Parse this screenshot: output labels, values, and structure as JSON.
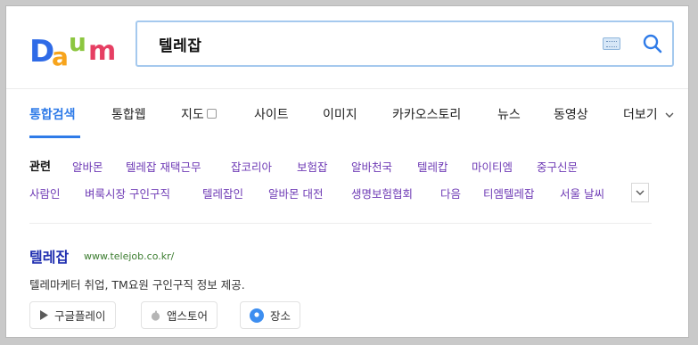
{
  "logo": {
    "text": "Daum",
    "colors": [
      "#2f6be7",
      "#f7a41c",
      "#8cc63f",
      "#e63f63"
    ]
  },
  "search": {
    "value": "텔레잡"
  },
  "tabs": [
    {
      "label": "통합검색",
      "active": true
    },
    {
      "label": "통합웹"
    },
    {
      "label": "지도"
    },
    {
      "label": "사이트"
    },
    {
      "label": "이미지"
    },
    {
      "label": "카카오스토리"
    },
    {
      "label": "뉴스"
    },
    {
      "label": "동영상"
    },
    {
      "label": "더보기"
    }
  ],
  "related": {
    "label": "관련",
    "row1": [
      "알바몬",
      "텔레잡 재택근무",
      "잡코리아",
      "보험잡",
      "알바천국",
      "텔레캅",
      "마이티엠",
      "중구신문"
    ],
    "row2": [
      "사람인",
      "벼룩시장 구인구직",
      "텔레잡인",
      "알바몬 대전",
      "생명보험협회",
      "다음",
      "티엠텔레잡",
      "서울 날씨"
    ]
  },
  "result": {
    "title": "텔레잡",
    "url": "www.telejob.co.kr/",
    "description": "텔레마케터 취업, TM요원 구인구직 정보 제공.",
    "buttons": [
      "구글플레이",
      "앱스토어",
      "장소"
    ]
  },
  "colors": {
    "accent": "#2f7be8",
    "related": "#6e3ab5",
    "title": "#1f2eb0",
    "url": "#3c7d30"
  }
}
